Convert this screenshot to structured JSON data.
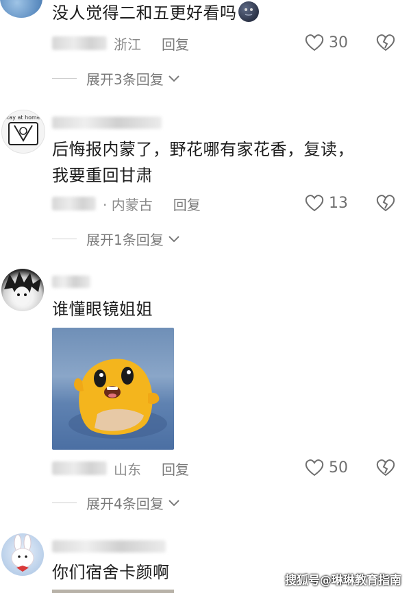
{
  "comments": [
    {
      "text": "没人觉得二和五更好看吗",
      "location": "浙江",
      "reply_label": "回复",
      "likes": "30",
      "expand_label": "展开3条回复"
    },
    {
      "text_line1": "后悔报内蒙了，野花哪有家花香，复读，",
      "text_line2": "我要重回甘肃",
      "avatar_text": "stay at home",
      "location": "· 内蒙古",
      "reply_label": "回复",
      "likes": "13",
      "expand_label": "展开1条回复"
    },
    {
      "text": "谁懂眼镜姐姐",
      "location": "山东",
      "reply_label": "回复",
      "likes": "50",
      "expand_label": "展开4条回复"
    },
    {
      "text": "你们宿舍卡颜啊"
    }
  ],
  "watermark": "搜狐号@琳琳教育指南",
  "icons": {
    "like": "heart-outline-icon",
    "dislike": "broken-heart-icon",
    "expand": "chevron-down-icon",
    "emoji": "dark-moon-emoji-icon"
  },
  "colors": {
    "text": "#1c1c1c",
    "meta": "#8a8a8a",
    "background": "#ffffff"
  }
}
